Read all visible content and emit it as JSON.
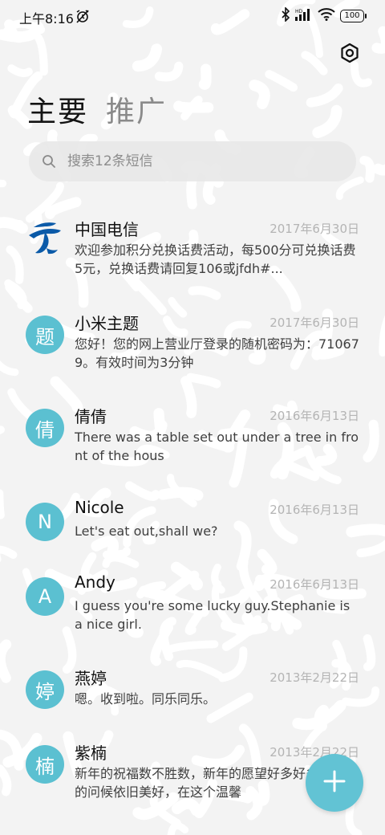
{
  "status_bar": {
    "time": "上午8:16",
    "icons": [
      "alarm-off-icon",
      "bluetooth-icon",
      "signal-icon",
      "wifi-icon"
    ],
    "battery": "100"
  },
  "header": {
    "tab_main": "主要",
    "tab_promo": "推广",
    "settings_icon": "gear-icon"
  },
  "search": {
    "placeholder": "搜索12条短信"
  },
  "threads": [
    {
      "name": "中国电信",
      "date": "2017年6月30日",
      "preview": "欢迎参加积分兑换话费活动，每500分可兑换话费5元，兑换话费请回复106或jfdh#...",
      "avatar": "",
      "avatar_icon": "china-telecom-logo-icon"
    },
    {
      "name": "小米主题",
      "date": "2017年6月30日",
      "preview": "您好！您的网上营业厅登录的随机密码为：710679。有效时间为3分钟",
      "avatar": "题"
    },
    {
      "name": "倩倩",
      "date": "2016年6月13日",
      "preview": "There was a table set out under a tree in front of the hous",
      "avatar": "倩"
    },
    {
      "name": "Nicole",
      "date": "2016年6月13日",
      "preview": "Let's eat out,shall we?",
      "avatar": "N"
    },
    {
      "name": "Andy",
      "date": "2016年6月13日",
      "preview": "I guess you're some lucky guy.Stephanie is a nice girl.",
      "avatar": "A"
    },
    {
      "name": "燕婷",
      "date": "2013年2月22日",
      "preview": "嗯。收到啦。同乐同乐。",
      "avatar": "婷"
    },
    {
      "name": "紫楠",
      "date": "2013年2月22日",
      "preview": "新年的祝福数不胜数，新年的愿望好多好多，新年的问候依旧美好，在这个温馨",
      "avatar": "楠"
    }
  ],
  "fab": {
    "icon": "plus-icon"
  },
  "colors": {
    "accent": "#5bc0d1",
    "fab": "#62c3d4",
    "date_text": "#b4b4b4",
    "telecom_blue": "#0b5aa8"
  }
}
